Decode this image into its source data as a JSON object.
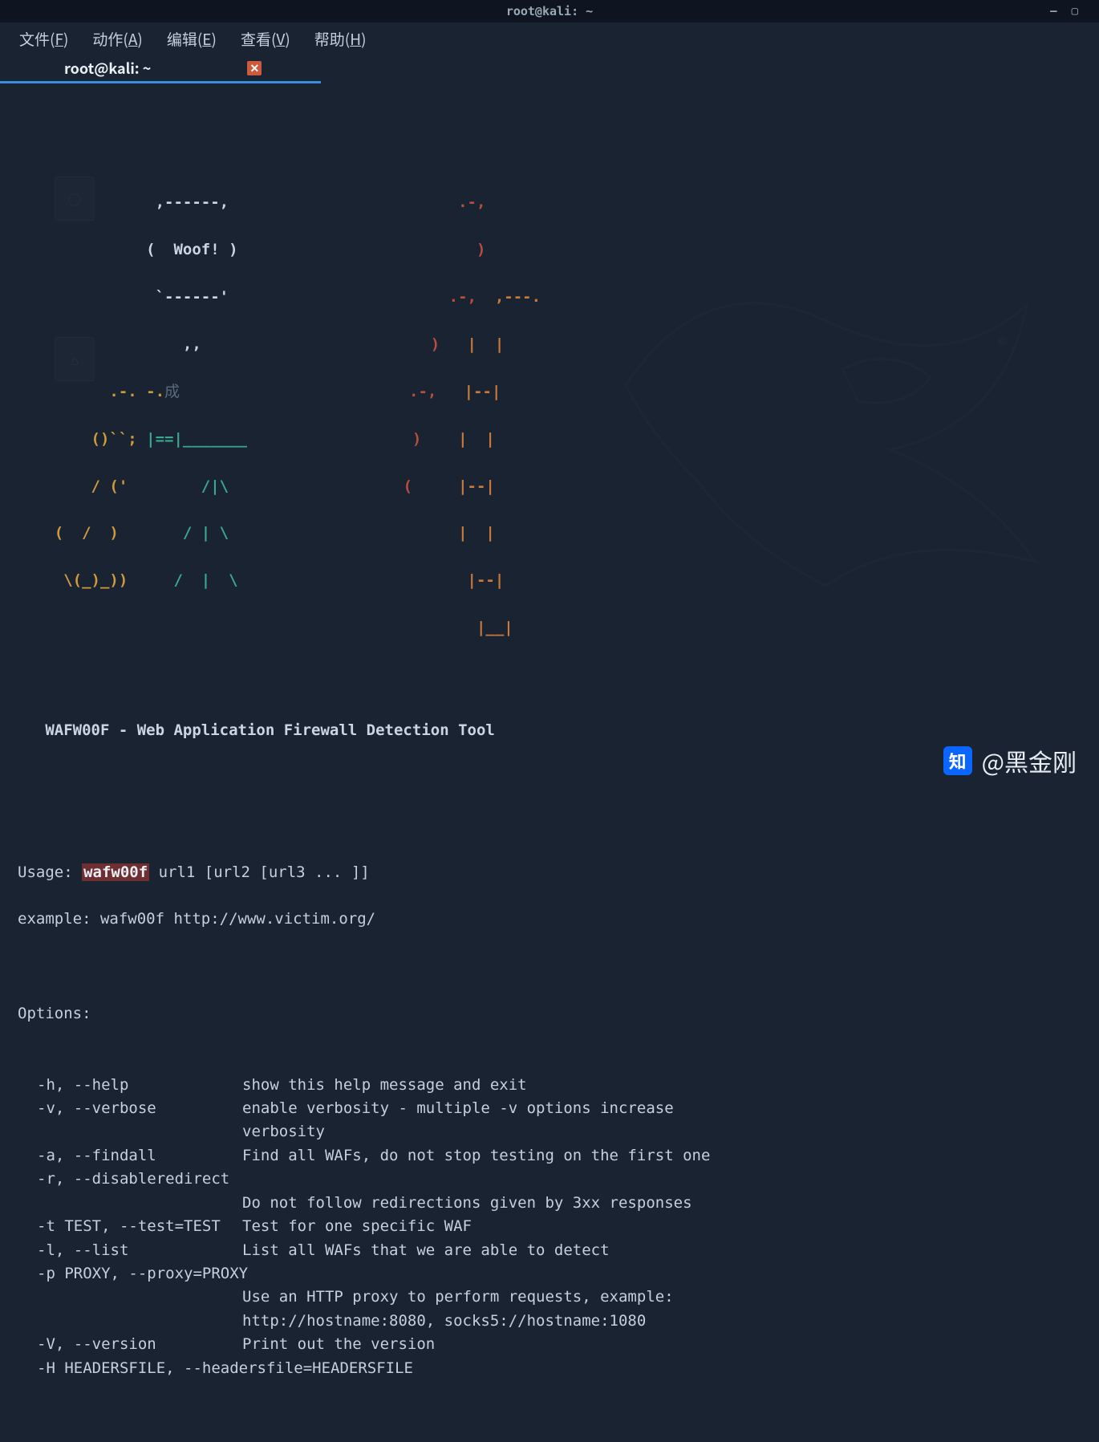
{
  "window": {
    "title": "root@kali: ~",
    "controls": {
      "minimize": "—",
      "maximize": "▢",
      "close_hint": ""
    }
  },
  "menubar": {
    "file": {
      "label": "文件",
      "hotkey": "F"
    },
    "action": {
      "label": "动作",
      "hotkey": "A"
    },
    "edit": {
      "label": "编辑",
      "hotkey": "E"
    },
    "view": {
      "label": "查看",
      "hotkey": "V"
    },
    "help": {
      "label": "帮助",
      "hotkey": "H"
    }
  },
  "tab": {
    "title": "root@kali: ~"
  },
  "ascii": {
    "woof_top": "               ,------,",
    "woof_mid": "              (  Woof! )",
    "woof_bot": "               `------'",
    "woof_tail": "                  ,,",
    "dog1": "          .-. -.成",
    "dog2": "        ()``; |==|_______",
    "dog3": "        / ('        /|\\",
    "dog4": "    (  /  )       / | \\",
    "dog5": "     \\(_)_))     /  |  \\",
    "fw_top": "                         .-,",
    "fw_l1": "                          )",
    "fw_l2": "                        .-,  ,---.",
    "fw_l3": "                         )   |  |",
    "fw_l4": "                       .-,   |--|",
    "fw_l5": "                        )    |  |",
    "fw_l6": "                       (     |--|",
    "fw_l7": "                             |  |",
    "fw_l8": "                             |--|",
    "fw_l9": "                             |__|"
  },
  "banner": "   WAFW00F - Web Application Firewall Detection Tool",
  "usage": {
    "label": "Usage: ",
    "cmd": "wafw00f",
    "args": " url1 [url2 [url3 ... ]]"
  },
  "example": "example: wafw00f http://www.victim.org/",
  "options_header": "Options:",
  "options": [
    {
      "flag": "-h, --help",
      "desc": "show this help message and exit"
    },
    {
      "flag": "-v, --verbose",
      "desc": "enable verbosity - multiple -v options increase",
      "cont": "verbosity"
    },
    {
      "flag": "-a, --findall",
      "desc": "Find all WAFs, do not stop testing on the first one"
    },
    {
      "flag": "-r, --disableredirect",
      "desc": "",
      "cont": "Do not follow redirections given by 3xx responses"
    },
    {
      "flag": "-t TEST, --test=TEST",
      "desc": "Test for one specific WAF"
    },
    {
      "flag": "-l, --list",
      "desc": "List all WAFs that we are able to detect"
    },
    {
      "flag": "-p PROXY, --proxy=PROXY",
      "desc": "",
      "cont": "Use an HTTP proxy to perform requests, example:",
      "cont2": "http://hostname:8080, socks5://hostname:1080"
    },
    {
      "flag": "-V, --version",
      "desc": "Print out the version"
    },
    {
      "flag": "-H HEADERSFILE, --headersfile=HEADERSFILE",
      "desc": ""
    }
  ],
  "watermark": {
    "logo": "知",
    "text": "@黑金刚"
  },
  "colors": {
    "bg": "#1a2332",
    "accent_blue": "#3a8cde",
    "teal": "#3aa88f",
    "yellow": "#d09a3a",
    "red": "#b94d3e",
    "orange": "#c97a3a"
  }
}
